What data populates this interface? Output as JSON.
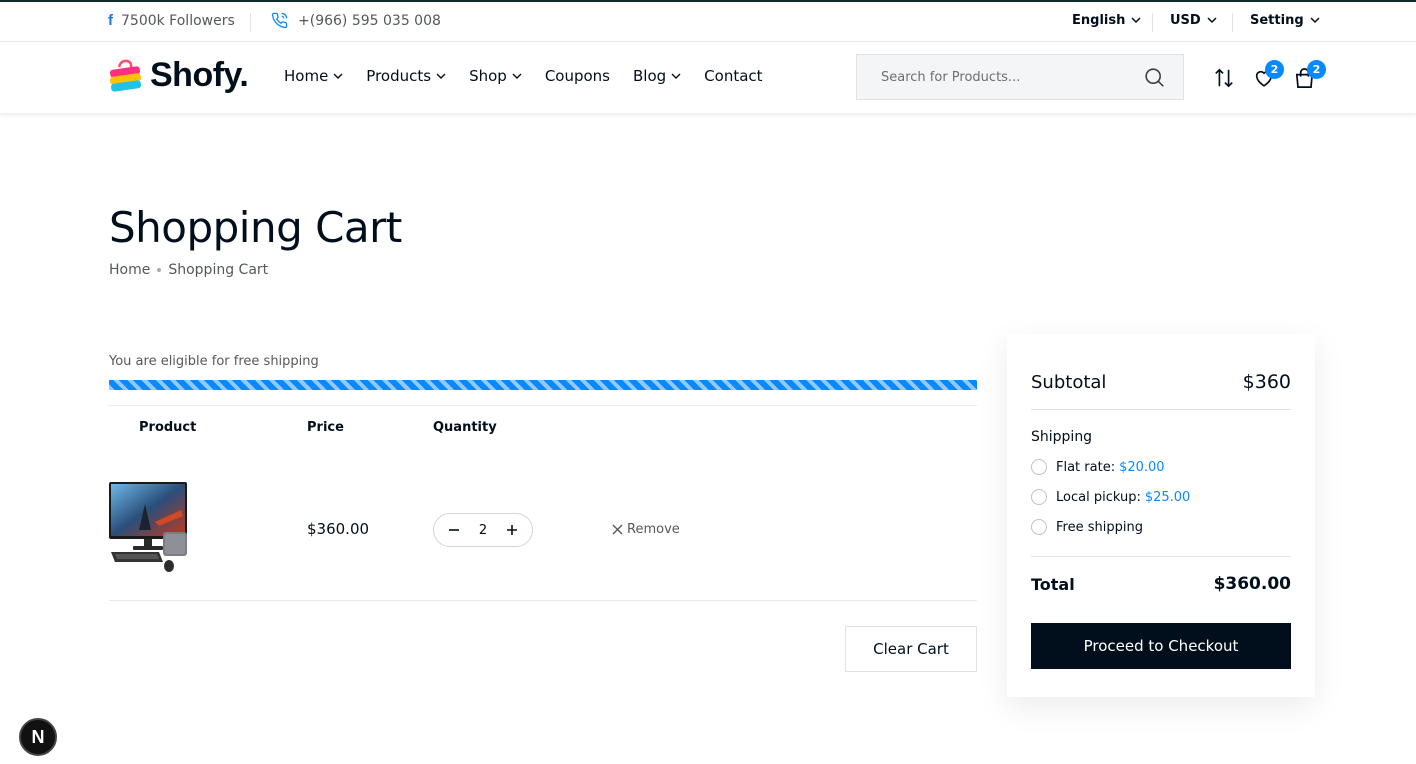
{
  "topbar": {
    "followers": "7500k Followers",
    "phone": "+(966) 595 035 008",
    "language": "English",
    "currency": "USD",
    "setting": "Setting"
  },
  "header": {
    "logo_text": "Shofy.",
    "nav": [
      "Home",
      "Products",
      "Shop",
      "Coupons",
      "Blog",
      "Contact"
    ],
    "search_placeholder": "Search for Products...",
    "wishlist_count": "2",
    "cart_count": "2"
  },
  "page": {
    "title": "Shopping Cart",
    "breadcrumb_home": "Home",
    "breadcrumb_current": "Shopping Cart"
  },
  "cart": {
    "free_shipping_text": "You are eligible for free shipping",
    "free_shipping_progress": 1.0,
    "columns": {
      "product": "Product",
      "price": "Price",
      "quantity": "Quantity"
    },
    "item": {
      "price": "$360.00",
      "quantity": "2",
      "remove_label": "Remove"
    },
    "clear_label": "Clear Cart"
  },
  "summary": {
    "subtotal_label": "Subtotal",
    "subtotal_value": "$360",
    "shipping_label": "Shipping",
    "options": [
      {
        "label": "Flat rate:",
        "amount": "$20.00"
      },
      {
        "label": "Local pickup:",
        "amount": "$25.00"
      },
      {
        "label": "Free shipping",
        "amount": ""
      }
    ],
    "total_label": "Total",
    "total_value": "$360.00",
    "checkout_label": "Proceed to Checkout"
  },
  "colors": {
    "accent": "#0989ff",
    "dark": "#010f1c"
  },
  "badge_letter": "N"
}
